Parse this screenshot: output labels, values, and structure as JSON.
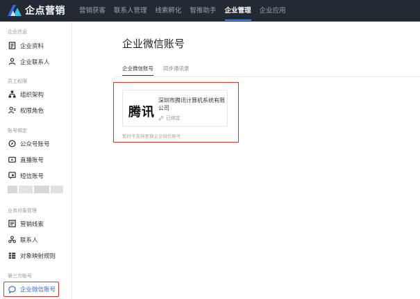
{
  "brand": {
    "name": "企点营销"
  },
  "nav": {
    "items": [
      "营销获客",
      "联系人管理",
      "线索孵化",
      "智推助手",
      "企业管理",
      "企业应用"
    ],
    "active_index": 4
  },
  "sidebar": {
    "groups": [
      {
        "title": "企业信息",
        "items": [
          {
            "label": "企业资料",
            "icon": "document-icon"
          },
          {
            "label": "企业联系人",
            "icon": "user-icon"
          }
        ]
      },
      {
        "title": "员工权限",
        "items": [
          {
            "label": "组织架构",
            "icon": "org-tree-icon"
          },
          {
            "label": "权限角色",
            "icon": "user-role-icon"
          }
        ]
      },
      {
        "title": "账号绑定",
        "items": [
          {
            "label": "公众号账号",
            "icon": "compass-icon"
          },
          {
            "label": "直播账号",
            "icon": "live-icon"
          },
          {
            "label": "短信账号",
            "icon": "sms-icon"
          }
        ]
      },
      {
        "title": "业务对象管理",
        "items": [
          {
            "label": "营销线索",
            "icon": "clue-icon"
          },
          {
            "label": "联系人",
            "icon": "contacts-icon"
          },
          {
            "label": "对象映射规则",
            "icon": "mapping-icon"
          }
        ]
      },
      {
        "title": "第三方账号",
        "items": [
          {
            "label": "企业微信账号",
            "icon": "chat-bubble-icon"
          }
        ]
      }
    ],
    "active_item": "企业微信账号"
  },
  "main": {
    "title": "企业微信账号",
    "tabs": [
      {
        "label": "企业微信账号",
        "active": true
      },
      {
        "label": "同步通讯录",
        "active": false
      }
    ],
    "card": {
      "logo_text": "腾讯",
      "company_name": "深圳市腾讯计算机系统有限公司",
      "status": "已绑定",
      "status_icon": "link-icon"
    },
    "hint": "暂时不支持更换企业微信账号"
  },
  "colors": {
    "topbar_bg": "#232a34",
    "accent": "#2f6be6",
    "annotation_red": "#e0302a"
  }
}
